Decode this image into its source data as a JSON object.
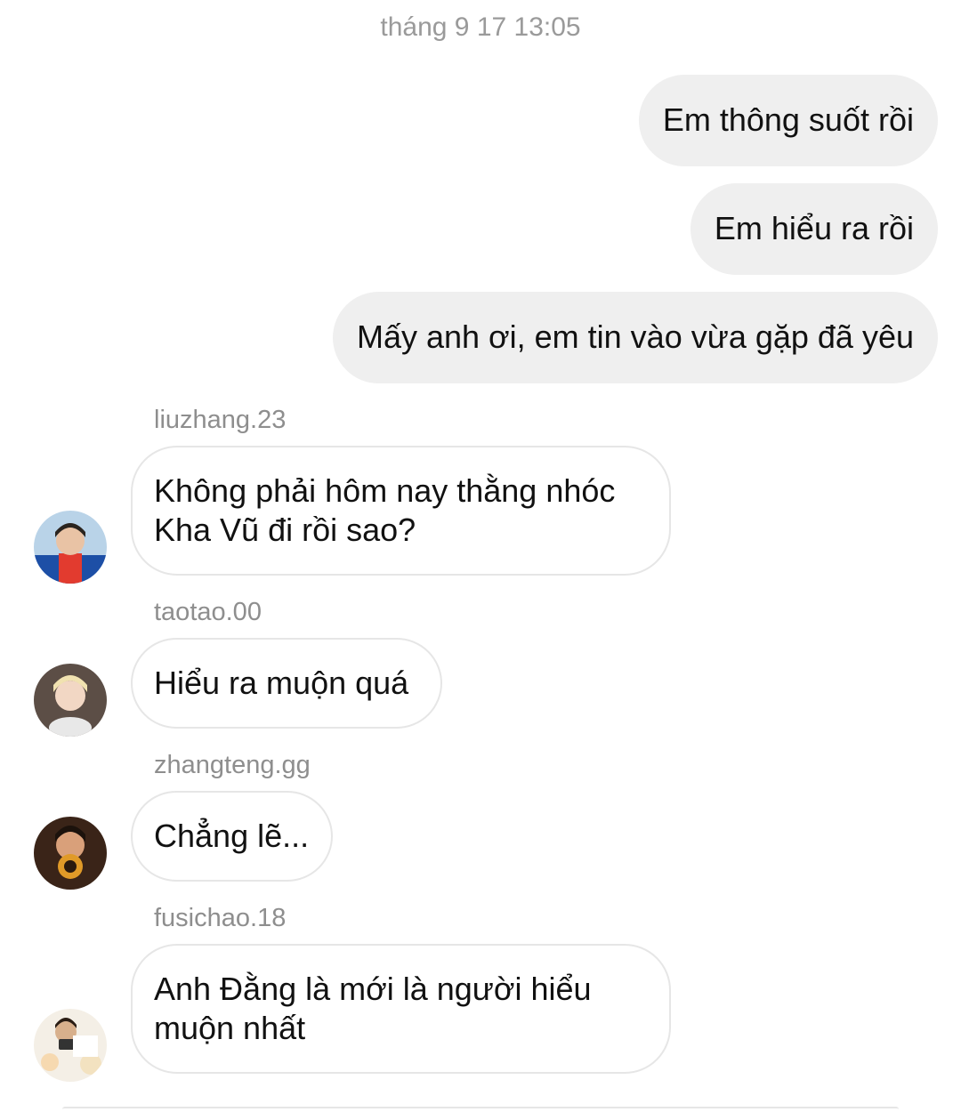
{
  "timestamp": "tháng 9 17 13:05",
  "outgoing": [
    {
      "text": "Em thông suốt rồi"
    },
    {
      "text": "Em hiểu ra rồi"
    },
    {
      "text": "Mấy anh ơi, em tin vào vừa gặp đã yêu"
    }
  ],
  "incoming": [
    {
      "sender": "liuzhang.23",
      "line1": "Không phải hôm nay thằng nhóc",
      "line2": "Kha Vũ đi rồi sao?"
    },
    {
      "sender": "taotao.00",
      "line1": "Hiểu ra muộn quá",
      "line2": ""
    },
    {
      "sender": "zhangteng.gg",
      "line1": "Chẳng lẽ...",
      "line2": ""
    },
    {
      "sender": "fusichao.18",
      "line1": "Anh Đằng là mới là người hiểu",
      "line2": "muộn nhất"
    }
  ]
}
